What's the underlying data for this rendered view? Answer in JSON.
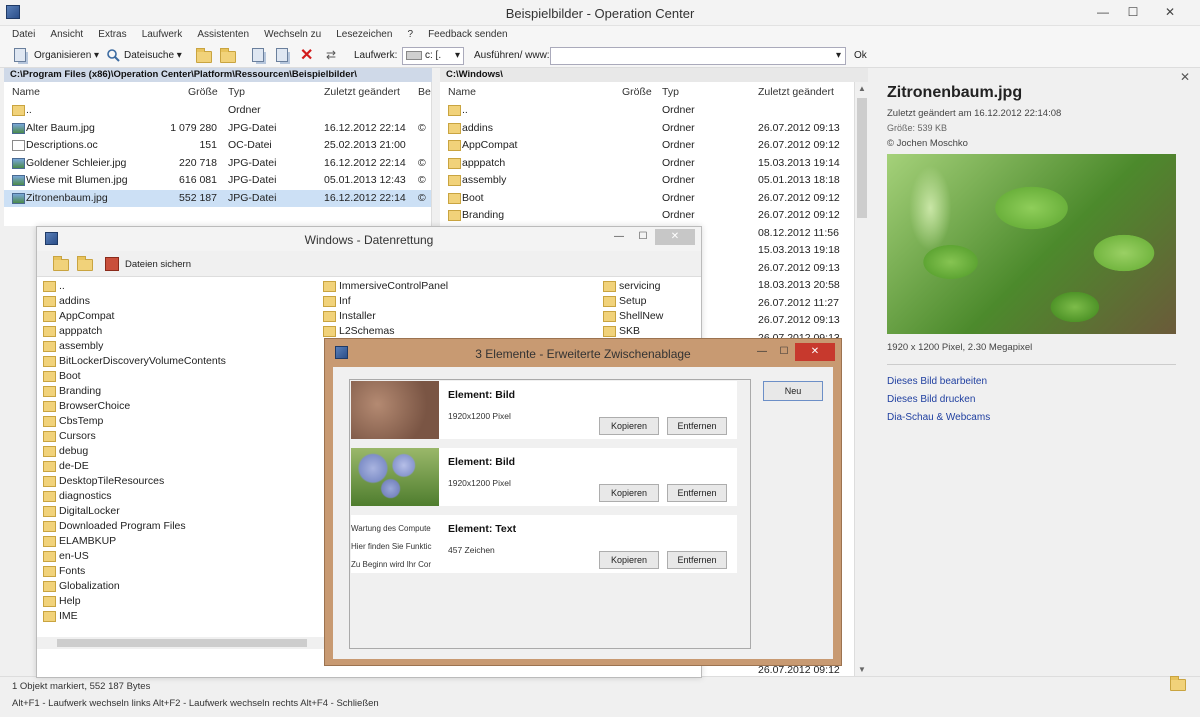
{
  "window": {
    "title": "Beispielbilder - Operation Center"
  },
  "menu": [
    "Datei",
    "Ansicht",
    "Extras",
    "Laufwerk",
    "Assistenten",
    "Wechseln zu",
    "Lesezeichen",
    "?",
    "Feedback senden"
  ],
  "toolbar": {
    "organize": "Organisieren",
    "file_search": "Dateisuche",
    "drive_label": "Laufwerk:",
    "drive_value": "c: [.",
    "run_label": "Ausführen/ www:",
    "run_value": "",
    "ok": "Ok"
  },
  "left_panel": {
    "path": "C:\\Program Files (x86)\\Operation Center\\Platform\\Ressourcen\\Beispielbilder\\",
    "headers": {
      "name": "Name",
      "size": "Größe",
      "type": "Typ",
      "modified": "Zuletzt geändert",
      "extra": "Be"
    },
    "rows": [
      {
        "name": "..",
        "size": "",
        "type": "Ordner",
        "modified": "",
        "extra": "",
        "icon": "folder"
      },
      {
        "name": "Alter Baum.jpg",
        "size": "1 079 280",
        "type": "JPG-Datei",
        "modified": "16.12.2012 22:14",
        "extra": "©",
        "icon": "img"
      },
      {
        "name": "Descriptions.oc",
        "size": "151",
        "type": "OC-Datei",
        "modified": "25.02.2013 21:00",
        "extra": "",
        "icon": "doc"
      },
      {
        "name": "Goldener Schleier.jpg",
        "size": "220 718",
        "type": "JPG-Datei",
        "modified": "16.12.2012 22:14",
        "extra": "©",
        "icon": "img"
      },
      {
        "name": "Wiese mit Blumen.jpg",
        "size": "616 081",
        "type": "JPG-Datei",
        "modified": "05.01.2013 12:43",
        "extra": "©",
        "icon": "img"
      },
      {
        "name": "Zitronenbaum.jpg",
        "size": "552 187",
        "type": "JPG-Datei",
        "modified": "16.12.2012 22:14",
        "extra": "©",
        "icon": "img",
        "selected": true
      }
    ]
  },
  "right_panel": {
    "path": "C:\\Windows\\",
    "headers": {
      "name": "Name",
      "size": "Größe",
      "type": "Typ",
      "modified": "Zuletzt geändert"
    },
    "rows": [
      {
        "name": "..",
        "type": "Ordner",
        "modified": ""
      },
      {
        "name": "addins",
        "type": "Ordner",
        "modified": "26.07.2012 09:13"
      },
      {
        "name": "AppCompat",
        "type": "Ordner",
        "modified": "26.07.2012 09:12"
      },
      {
        "name": "apppatch",
        "type": "Ordner",
        "modified": "15.03.2013 19:14"
      },
      {
        "name": "assembly",
        "type": "Ordner",
        "modified": "05.01.2013 18:18"
      },
      {
        "name": "Boot",
        "type": "Ordner",
        "modified": "26.07.2012 09:12"
      },
      {
        "name": "Branding",
        "type": "Ordner",
        "modified": "26.07.2012 09:12"
      },
      {
        "name": "",
        "type": "",
        "modified": "08.12.2012 11:56"
      },
      {
        "name": "",
        "type": "",
        "modified": "15.03.2013 19:18"
      },
      {
        "name": "",
        "type": "",
        "modified": "26.07.2012 09:13"
      },
      {
        "name": "",
        "type": "",
        "modified": "18.03.2013 20:58"
      },
      {
        "name": "",
        "type": "",
        "modified": "26.07.2012 11:27"
      },
      {
        "name": "",
        "type": "",
        "modified": "26.07.2012 09:13"
      },
      {
        "name": "",
        "type": "",
        "modified": "26.07.2012 09:13"
      }
    ],
    "last_modified": "26.07.2012 09:12"
  },
  "preview": {
    "title": "Zitronenbaum.jpg",
    "modified": "Zuletzt geändert am 16.12.2012 22:14:08",
    "size": "Größe: 539 KB",
    "copyright": "© Jochen Moschko",
    "dimensions": "1920 x 1200 Pixel, 2.30 Megapixel",
    "links": [
      "Dieses Bild bearbeiten",
      "Dieses Bild drucken",
      "Dia-Schau & Webcams"
    ]
  },
  "recovery_window": {
    "title": "Windows - Datenrettung",
    "save_label": "Dateien sichern",
    "col1": [
      "..",
      "addins",
      "AppCompat",
      "apppatch",
      "assembly",
      "BitLockerDiscoveryVolumeContents",
      "Boot",
      "Branding",
      "BrowserChoice",
      "CbsTemp",
      "Cursors",
      "debug",
      "de-DE",
      "DesktopTileResources",
      "diagnostics",
      "DigitalLocker",
      "Downloaded Program Files",
      "ELAMBKUP",
      "en-US",
      "Fonts",
      "Globalization",
      "Help",
      "IME"
    ],
    "col2": [
      "ImmersiveControlPanel",
      "Inf",
      "Installer",
      "L2Schemas"
    ],
    "col3": [
      "servicing",
      "Setup",
      "ShellNew",
      "SKB"
    ]
  },
  "clipboard_window": {
    "title": "3 Elemente - Erweiterte Zwischenablage",
    "new_button": "Neu",
    "entries": [
      {
        "title": "Element: Bild",
        "desc": "1920x1200 Pixel",
        "copy": "Kopieren",
        "remove": "Entfernen",
        "kind": "image-bark"
      },
      {
        "title": "Element: Bild",
        "desc": "1920x1200 Pixel",
        "copy": "Kopieren",
        "remove": "Entfernen",
        "kind": "image-flowers"
      },
      {
        "title": "Element: Text",
        "desc": "457 Zeichen",
        "copy": "Kopieren",
        "remove": "Entfernen",
        "kind": "text",
        "preview_lines": [
          "Wartung des Compute",
          "Hier finden Sie Funktic",
          "Zu Beginn wird Ihr Cor"
        ]
      }
    ]
  },
  "status": {
    "line1": "1 Objekt markiert, 552 187 Bytes",
    "line2": "Alt+F1 - Laufwerk wechseln links   Alt+F2 - Laufwerk wechseln rechts   Alt+F4 - Schließen"
  }
}
